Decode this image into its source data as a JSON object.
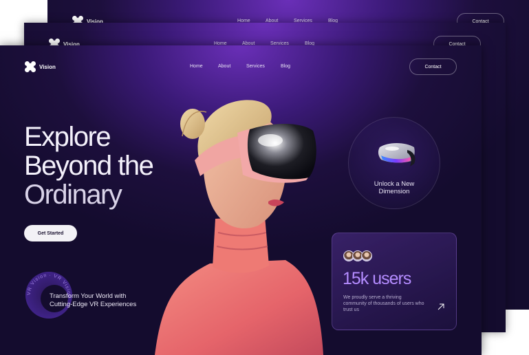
{
  "brand": {
    "name": "Vision"
  },
  "nav": {
    "items": [
      "Home",
      "About",
      "Services",
      "Blog"
    ],
    "contact_label": "Contact"
  },
  "hero": {
    "headline_lines": [
      "Explore",
      "Beyond the",
      "Ordinary"
    ],
    "cta_label": "Get Started",
    "badge_text": "VR Vision · VR Vision ·",
    "transform_text": "Transform Your World with Cutting-Edge VR Experiences"
  },
  "feature": {
    "line1": "Unlock a New",
    "line2": "Dimension"
  },
  "stats": {
    "value": "15k users",
    "description": "We proudly serve a thriving community of thousands of users who trust us"
  },
  "colors": {
    "background_dark": "#140c2e",
    "accent_purple": "#6a2fb8",
    "stat_purple": "#b48cff"
  }
}
